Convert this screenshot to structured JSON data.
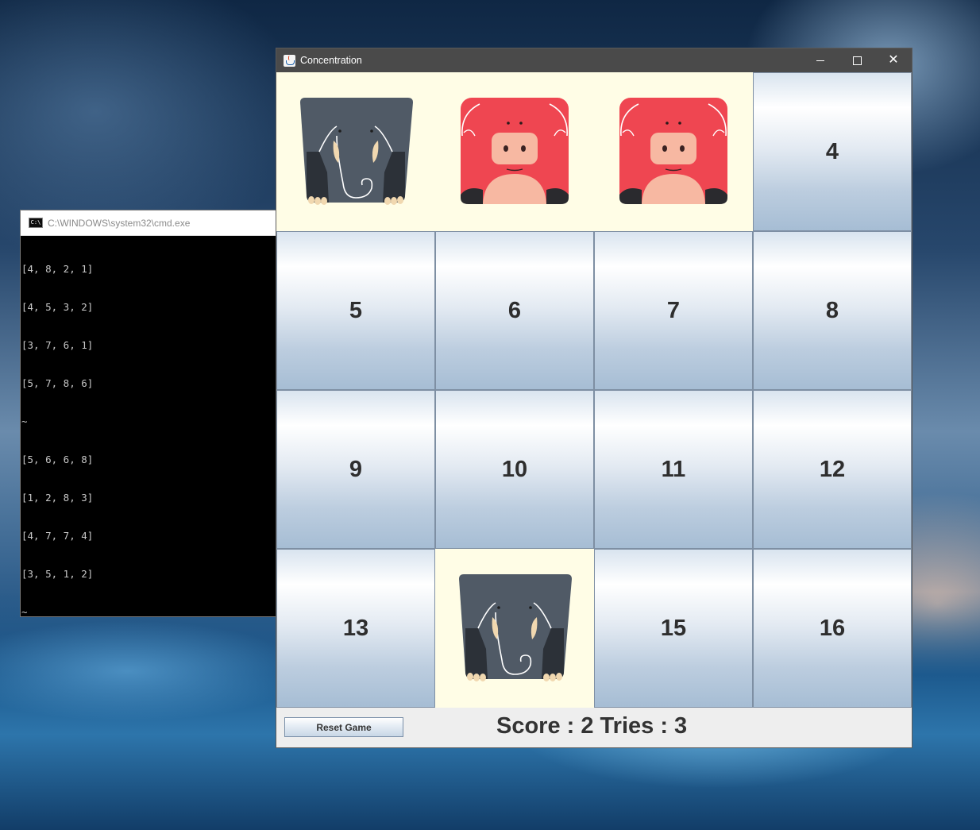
{
  "cmd": {
    "title": "C:\\WINDOWS\\system32\\cmd.exe",
    "icon_text": "C:\\",
    "lines": [
      "[4, 8, 2, 1]",
      "[4, 5, 3, 2]",
      "[3, 7, 6, 1]",
      "[5, 7, 8, 6]",
      "~",
      "[5, 6, 6, 8]",
      "[1, 2, 8, 3]",
      "[4, 7, 7, 4]",
      "[3, 5, 1, 2]",
      "~"
    ]
  },
  "window": {
    "title": "Concentration",
    "icon": "java-icon"
  },
  "cards": [
    {
      "label": "",
      "face": "elephant"
    },
    {
      "label": "",
      "face": "pig"
    },
    {
      "label": "",
      "face": "pig"
    },
    {
      "label": "4"
    },
    {
      "label": "5"
    },
    {
      "label": "6"
    },
    {
      "label": "7"
    },
    {
      "label": "8"
    },
    {
      "label": "9"
    },
    {
      "label": "10"
    },
    {
      "label": "11"
    },
    {
      "label": "12"
    },
    {
      "label": "13"
    },
    {
      "label": "",
      "face": "elephant"
    },
    {
      "label": "15"
    },
    {
      "label": "16"
    }
  ],
  "footer": {
    "reset_label": "Reset Game",
    "score_text": "Score : 2 Tries : 3"
  },
  "colors": {
    "revealed_bg": "#fffde6",
    "pig": "#ef4651",
    "elephant": "#505a66"
  }
}
